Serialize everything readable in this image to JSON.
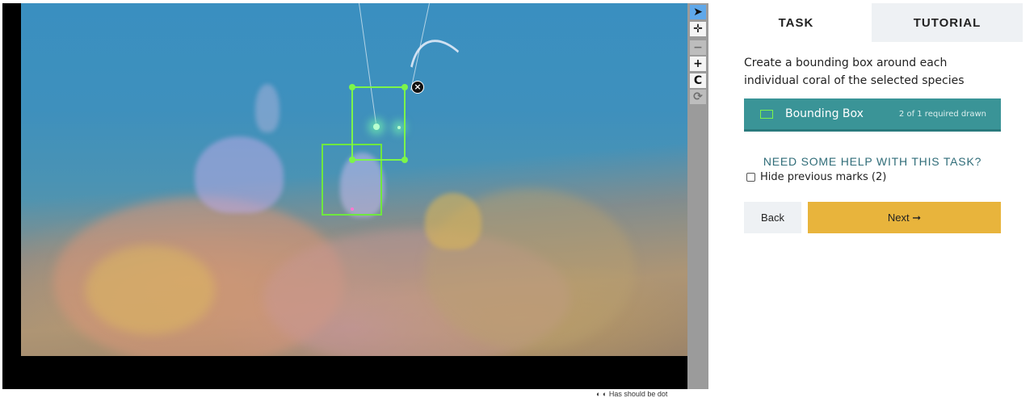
{
  "subject_viewer": {
    "marks": [
      {
        "name": "selected-mark",
        "shape": "bounding-box",
        "color": "#7cf54a"
      },
      {
        "name": "previous-mark",
        "shape": "bounding-box",
        "color": "#6fe83e"
      }
    ],
    "delete_label": "×"
  },
  "toolbar": {
    "tools": [
      {
        "name": "annotate-tool",
        "icon": "pointer-icon",
        "glyph": "➤",
        "state": "active"
      },
      {
        "name": "move-tool",
        "icon": "move-icon",
        "glyph": "✛",
        "state": "normal"
      },
      {
        "name": "zoom-out-tool",
        "icon": "minus-icon",
        "glyph": "−",
        "state": "disabled"
      },
      {
        "name": "zoom-in-tool",
        "icon": "plus-icon",
        "glyph": "+",
        "state": "normal"
      },
      {
        "name": "rotate-tool",
        "icon": "rotate-icon",
        "glyph": "C",
        "state": "normal"
      },
      {
        "name": "reset-tool",
        "icon": "reset-icon",
        "glyph": "⟳",
        "state": "disabled"
      }
    ]
  },
  "footer": {
    "text": "◐ ◐ Has should be dot"
  },
  "panel": {
    "tabs": [
      {
        "label": "TASK",
        "active": true
      },
      {
        "label": "TUTORIAL",
        "active": false
      }
    ],
    "instruction": "Create a bounding box around each individual coral of the selected species",
    "tool": {
      "label": "Bounding Box",
      "count": "2 of 1 required drawn",
      "swatch_color": "#7cf54a"
    },
    "help_link": "NEED SOME HELP WITH THIS TASK?",
    "hide_marks_label": "Hide previous marks (2)",
    "back_label": "Back",
    "next_label": "Next ➞"
  },
  "colors": {
    "accent_teal": "#3a9497",
    "next_yellow": "#e8b43c",
    "active_tool_blue": "#5fa8ea",
    "mark_green": "#7cf54a"
  }
}
